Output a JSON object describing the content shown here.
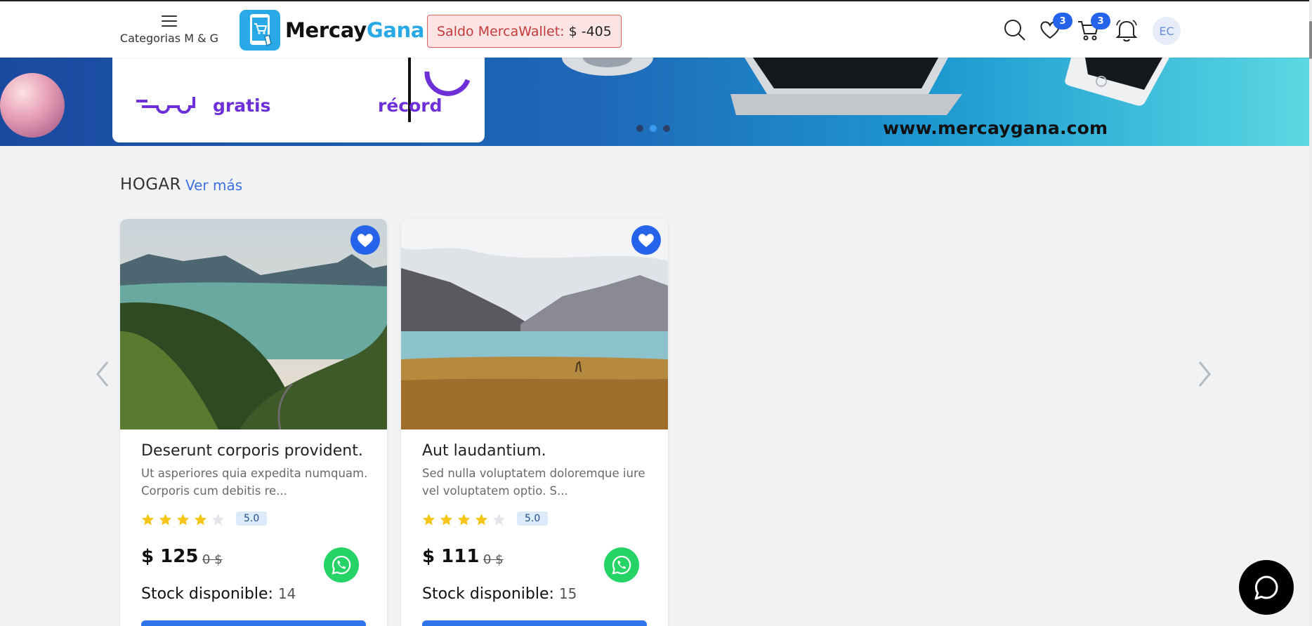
{
  "header": {
    "menu_label": "Categorias M & G",
    "logo_word1": "Mercay",
    "logo_word2": "Gana",
    "wallet_label": "Saldo MercaWallet:",
    "wallet_amount": "$ -405",
    "favorites_count": "3",
    "cart_count": "3",
    "avatar_initials": "EC"
  },
  "banner": {
    "promo_left": "gratis",
    "promo_right": "récord",
    "url": "www.mercaygana.com",
    "slides": 3,
    "active_slide": 2
  },
  "section": {
    "title": "HOGAR",
    "see_more": "Ver más"
  },
  "products": [
    {
      "title": "Deserunt corporis provident.",
      "description": "Ut asperiores quia expedita numquam. Corporis cum debitis re...",
      "stars_filled": 4,
      "stars_total": 5,
      "rating": "5.0",
      "price": "$ 125",
      "old_price": "0 $",
      "stock_label": "Stock disponible:",
      "stock": "14"
    },
    {
      "title": "Aut laudantium.",
      "description": "Sed nulla voluptatem doloremque iure vel voluptatem optio. S...",
      "stars_filled": 4,
      "stars_total": 5,
      "rating": "5.0",
      "price": "$ 111",
      "old_price": "0 $",
      "stock_label": "Stock disponible:",
      "stock": "15"
    }
  ],
  "colors": {
    "accent": "#2563eb",
    "brand": "#2aa9e8",
    "whatsapp": "#25d366",
    "star": "#f5c518"
  }
}
